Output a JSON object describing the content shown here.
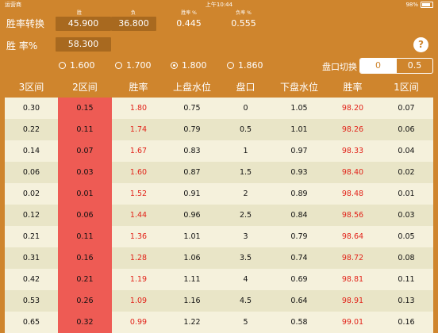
{
  "status": {
    "carrier": "运营商",
    "time": "上午10:44",
    "battery": "98%"
  },
  "stats": {
    "headers": [
      "胜",
      "负",
      "胜率 %",
      "负率 %"
    ],
    "convert_label": "胜率转换",
    "win": "45.900",
    "lose": "36.800",
    "win_rate": "0.445",
    "lose_rate": "0.555",
    "rate_label": "胜 率%",
    "rate_value": "58.300"
  },
  "options": {
    "labels": [
      "1.600",
      "1.700",
      "1.800",
      "1.860"
    ],
    "selected_index": 2
  },
  "switch": {
    "label": "盘口切换",
    "options": [
      "0",
      "0.5"
    ],
    "selected": "0"
  },
  "table": {
    "headers": [
      "3区间",
      "2区间",
      "胜率",
      "上盘水位",
      "盘口",
      "下盘水位",
      "胜率",
      "1区间"
    ],
    "rows": [
      [
        "0.30",
        "0.15",
        "1.80",
        "0.75",
        "0",
        "1.05",
        "98.20",
        "0.07"
      ],
      [
        "0.22",
        "0.11",
        "1.74",
        "0.79",
        "0.5",
        "1.01",
        "98.26",
        "0.06"
      ],
      [
        "0.14",
        "0.07",
        "1.67",
        "0.83",
        "1",
        "0.97",
        "98.33",
        "0.04"
      ],
      [
        "0.06",
        "0.03",
        "1.60",
        "0.87",
        "1.5",
        "0.93",
        "98.40",
        "0.02"
      ],
      [
        "0.02",
        "0.01",
        "1.52",
        "0.91",
        "2",
        "0.89",
        "98.48",
        "0.01"
      ],
      [
        "0.12",
        "0.06",
        "1.44",
        "0.96",
        "2.5",
        "0.84",
        "98.56",
        "0.03"
      ],
      [
        "0.21",
        "0.11",
        "1.36",
        "1.01",
        "3",
        "0.79",
        "98.64",
        "0.05"
      ],
      [
        "0.31",
        "0.16",
        "1.28",
        "1.06",
        "3.5",
        "0.74",
        "98.72",
        "0.08"
      ],
      [
        "0.42",
        "0.21",
        "1.19",
        "1.11",
        "4",
        "0.69",
        "98.81",
        "0.11"
      ],
      [
        "0.53",
        "0.26",
        "1.09",
        "1.16",
        "4.5",
        "0.64",
        "98.91",
        "0.13"
      ],
      [
        "0.65",
        "0.32",
        "0.99",
        "1.22",
        "5",
        "0.58",
        "99.01",
        "0.16"
      ]
    ]
  }
}
